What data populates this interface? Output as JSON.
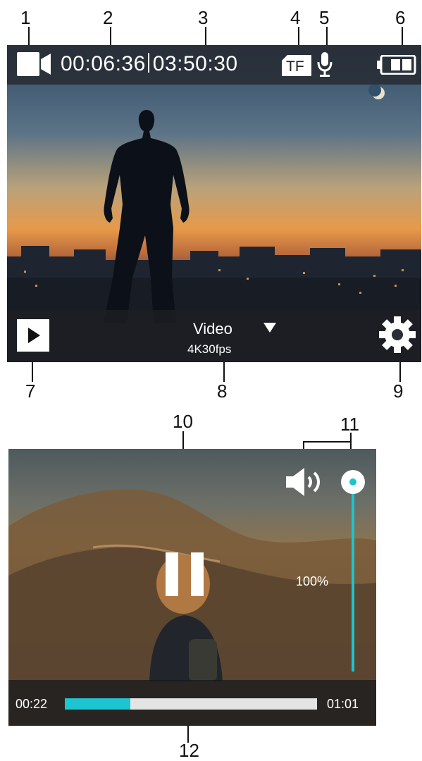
{
  "callouts": [
    "1",
    "2",
    "3",
    "4",
    "5",
    "6",
    "7",
    "8",
    "9",
    "10",
    "11",
    "12"
  ],
  "recording_screen": {
    "elapsed_time": "00:06:36",
    "remaining_time": "03:50:30",
    "storage_label": "TF",
    "mode_label": "Video",
    "resolution_label": "4K30fps",
    "icons": {
      "record_mode": "video-camera-icon",
      "storage": "tf-card-icon",
      "audio": "microphone-icon",
      "battery": "battery-icon",
      "playback": "play-icon",
      "mode_dropdown": "triangle-down-icon",
      "settings": "gear-icon"
    }
  },
  "playback_screen": {
    "volume_label": "100%",
    "volume_level": 1.0,
    "current_time": "00:22",
    "total_time": "01:01",
    "progress_fraction": 0.26,
    "icons": {
      "pause": "pause-icon",
      "volume": "speaker-icon",
      "volume_slider": "volume-slider-knob"
    }
  },
  "colors": {
    "accent": "#1cc5cf",
    "bar_background": "#282c34",
    "track": "#e4e4e4"
  }
}
